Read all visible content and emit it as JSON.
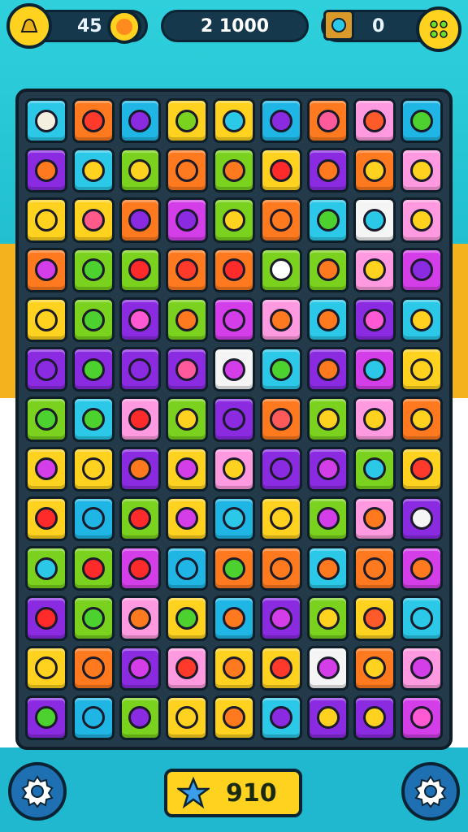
{
  "hud": {
    "left_value": "45",
    "center_value": "2 1000",
    "right_value": "0"
  },
  "bottom": {
    "score_label": "910"
  },
  "board": {
    "rows": 13,
    "cols": 9,
    "tile_colors": [
      [
        "#2bc8e8",
        "#ff7a1e",
        "#1fb6e6",
        "#ffd21f",
        "#ffd21f",
        "#1fb6e6",
        "#ff7a1e",
        "#ff9ae0",
        "#1fb6e6"
      ],
      [
        "#8a2be2",
        "#2bc8e8",
        "#7ad11e",
        "#ff7a1e",
        "#7ad11e",
        "#ffd21f",
        "#8a2be2",
        "#ff7a1e",
        "#ff9ae0"
      ],
      [
        "#ffd21f",
        "#ffd21f",
        "#ff7a1e",
        "#d43ee8",
        "#7ad11e",
        "#ff7a1e",
        "#2bc8e8",
        "#f5f5f5",
        "#ff9ae0"
      ],
      [
        "#ff7a1e",
        "#7ad11e",
        "#7ad11e",
        "#ff7a1e",
        "#ff7a1e",
        "#7ad11e",
        "#7ad11e",
        "#ff9ae0",
        "#d43ee8"
      ],
      [
        "#ffd21f",
        "#7ad11e",
        "#8a2be2",
        "#7ad11e",
        "#d43ee8",
        "#ff9ae0",
        "#2bc8e8",
        "#8a2be2",
        "#2bc8e8"
      ],
      [
        "#8a2be2",
        "#8a2be2",
        "#8a2be2",
        "#8a2be2",
        "#f5f5f5",
        "#2bc8e8",
        "#8a2be2",
        "#d43ee8",
        "#ffd21f"
      ],
      [
        "#7ad11e",
        "#2bc8e8",
        "#ff9ae0",
        "#7ad11e",
        "#8a2be2",
        "#ff7a1e",
        "#7ad11e",
        "#ff9ae0",
        "#ff7a1e"
      ],
      [
        "#ffd21f",
        "#ffd21f",
        "#8a2be2",
        "#ffd21f",
        "#ff9ae0",
        "#8a2be2",
        "#8a2be2",
        "#7ad11e",
        "#ffd21f"
      ],
      [
        "#ffd21f",
        "#1fb6e6",
        "#7ad11e",
        "#ffd21f",
        "#1fb6e6",
        "#ffd21f",
        "#7ad11e",
        "#ff9ae0",
        "#8a2be2"
      ],
      [
        "#7ad11e",
        "#7ad11e",
        "#d43ee8",
        "#1fb6e6",
        "#ff7a1e",
        "#ff7a1e",
        "#2bc8e8",
        "#ff7a1e",
        "#d43ee8"
      ],
      [
        "#8a2be2",
        "#7ad11e",
        "#ff9ae0",
        "#ffd21f",
        "#1fb6e6",
        "#8a2be2",
        "#7ad11e",
        "#ffd21f",
        "#2bc8e8"
      ],
      [
        "#ffd21f",
        "#ff7a1e",
        "#8a2be2",
        "#ff9ae0",
        "#ffd21f",
        "#ffd21f",
        "#f5f5f5",
        "#ff7a1e",
        "#ff9ae0"
      ],
      [
        "#8a2be2",
        "#1fb6e6",
        "#7ad11e",
        "#ffd21f",
        "#ffd21f",
        "#2bc8e8",
        "#8a2be2",
        "#8a2be2",
        "#d43ee8"
      ]
    ],
    "icon_colors": [
      [
        "#f4f0e0",
        "#ff3a2a",
        "#8a2be2",
        "#7ad11e",
        "#2bc8e8",
        "#8a2be2",
        "#ff5a9a",
        "#ff5a2a",
        "#4cd12e"
      ],
      [
        "#ff7a1e",
        "#ffd21f",
        "#ffd21f",
        "#ff7a1e",
        "#ff7a1e",
        "#ff2a2a",
        "#ff7a1e",
        "#ffd21f",
        "#ffd21f"
      ],
      [
        "#ffd21f",
        "#ff5a8a",
        "#8a2be2",
        "#8a2be2",
        "#ffd21f",
        "#ff7a1e",
        "#4cd12e",
        "#2bc8e8",
        "#ffd21f"
      ],
      [
        "#d43ee8",
        "#4cd12e",
        "#ff2a2a",
        "#ff3a2a",
        "#ff2a2a",
        "#ffffff",
        "#ff7a1e",
        "#ffd21f",
        "#8a2be2"
      ],
      [
        "#ffd21f",
        "#4cd12e",
        "#ff5ad4",
        "#ff7a1e",
        "#d43ee8",
        "#ff7a1e",
        "#ff7a1e",
        "#ff5ad4",
        "#ffd21f"
      ],
      [
        "#8a2be2",
        "#4cd12e",
        "#8a2be2",
        "#ff5a9a",
        "#d43ee8",
        "#4cd12e",
        "#ff7a1e",
        "#2bc8e8",
        "#ffd21f"
      ],
      [
        "#4cd12e",
        "#4cd12e",
        "#ff2a2a",
        "#ffd21f",
        "#8a2be2",
        "#ff5a5a",
        "#ffd21f",
        "#ffd21f",
        "#ffd21f"
      ],
      [
        "#d43ee8",
        "#ffd21f",
        "#ff7a1e",
        "#d43ee8",
        "#ffd21f",
        "#8a2be2",
        "#d43ee8",
        "#2bc8e8",
        "#ff3a2a"
      ],
      [
        "#ff2a2a",
        "#1fb6e6",
        "#ff2a2a",
        "#d43ee8",
        "#2bc8e8",
        "#ffd21f",
        "#d43ee8",
        "#ff7a1e",
        "#f5f5f5"
      ],
      [
        "#2bc8e8",
        "#ff2a2a",
        "#ff2a2a",
        "#1fb6e6",
        "#4cd12e",
        "#ff7a1e",
        "#ff7a1e",
        "#ff7a1e",
        "#ff7a1e"
      ],
      [
        "#ff2a2a",
        "#4cd12e",
        "#ff7a1e",
        "#4cd12e",
        "#ff7a1e",
        "#d43ee8",
        "#ffd21f",
        "#ff5a2a",
        "#2bc8e8"
      ],
      [
        "#ffd21f",
        "#ff7a1e",
        "#d43ee8",
        "#ff3a2a",
        "#ff7a1e",
        "#ff3a2a",
        "#d43ee8",
        "#ffd21f",
        "#d43ee8"
      ],
      [
        "#4cd12e",
        "#1fb6e6",
        "#8a2be2",
        "#ffd21f",
        "#ff7a1e",
        "#8a2be2",
        "#ffd21f",
        "#ffd21f",
        "#ff5ad4"
      ]
    ]
  }
}
